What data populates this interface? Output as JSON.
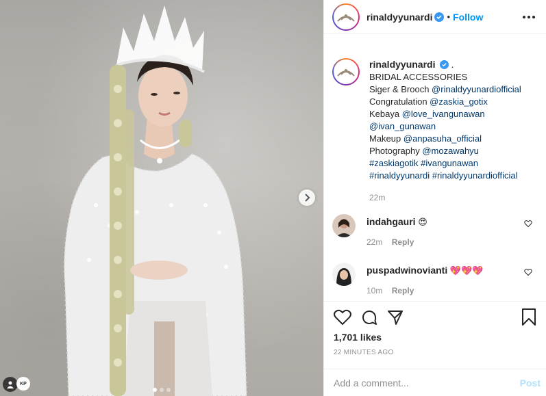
{
  "header": {
    "username": "rinaldyyunardi",
    "separator": "•",
    "follow_label": "Follow",
    "verified_icon": "verified-badge-icon",
    "more_icon": "more-options-icon"
  },
  "caption": {
    "username": "rinaldyyunardi",
    "suffix": ".",
    "lines": [
      {
        "text": "BRIDAL ACCESSORIES"
      },
      {
        "prefix": "Siger & Brooch ",
        "link": "@rinaldyyunardiofficial"
      },
      {
        "prefix": "Congratulation ",
        "link": "@zaskia_gotix"
      },
      {
        "prefix": "Kebaya ",
        "link": "@love_ivangunawan"
      },
      {
        "prefix": "",
        "link": "@ivan_gunawan"
      },
      {
        "prefix": "Makeup ",
        "link": "@anpasuha_official"
      },
      {
        "prefix": "Photography ",
        "link": "@mozawahyu"
      },
      {
        "prefix": "",
        "link": "#zaskiagotik #ivangunawan"
      },
      {
        "prefix": "",
        "link": "#rinaldyyunardi #rinaldyyunardiofficial"
      }
    ],
    "time": "22m"
  },
  "comments": [
    {
      "username": "indahgauri",
      "text": "😍",
      "time": "22m",
      "reply_label": "Reply"
    },
    {
      "username": "puspadwinovianti",
      "text": "💖💖💖",
      "time": "10m",
      "reply_label": "Reply"
    }
  ],
  "actions": {
    "like_icon": "heart-icon",
    "comment_icon": "comment-bubble-icon",
    "share_icon": "paper-plane-icon",
    "save_icon": "bookmark-icon",
    "likes_text": "1,701 likes",
    "time_ago": "22 MINUTES AGO"
  },
  "add_comment": {
    "placeholder": "Add a comment...",
    "post_label": "Post"
  },
  "photo": {
    "watermark": "KP",
    "next_icon": "chevron-right-icon",
    "tag_icon": "user-tag-icon",
    "slide_count": 3,
    "active_slide": 1
  },
  "colors": {
    "link": "#00376b",
    "follow": "#0095f6",
    "muted": "#8e8e8e",
    "post_disabled": "#b2dffc"
  }
}
